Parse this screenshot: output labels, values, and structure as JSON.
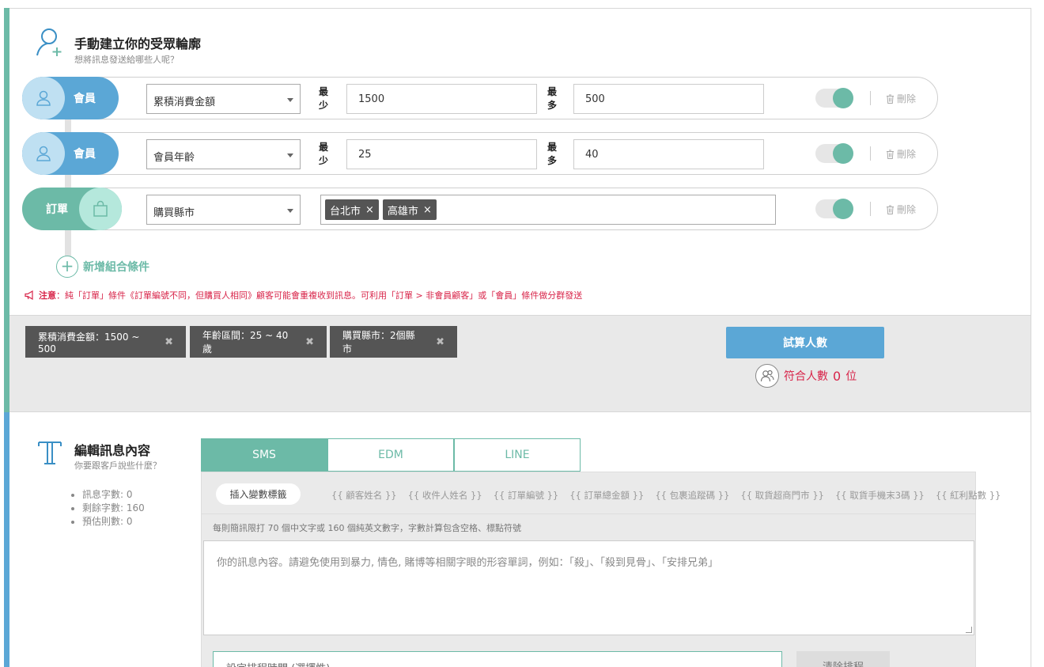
{
  "audience": {
    "title": "手動建立你的受眾輪廓",
    "subtitle": "想將訊息發送給哪些人呢？",
    "rules": [
      {
        "type_label": "會員",
        "field": "累積消費金額",
        "min_label": "最少",
        "min": "1500",
        "max_label": "最多",
        "max": "500",
        "delete_label": "刪除"
      },
      {
        "type_label": "會員",
        "field": "會員年齡",
        "min_label": "最少",
        "min": "25",
        "max_label": "最多",
        "max": "40",
        "delete_label": "刪除"
      },
      {
        "type_label": "訂單",
        "field": "購買縣市",
        "tags": [
          "台北市",
          "高雄市"
        ],
        "delete_label": "刪除"
      }
    ],
    "add_condition_label": "新增組合條件",
    "notice_prefix": "注意",
    "notice_text": "：純「訂單」條件《訂單編號不同，但購買人相同》顧客可能會重複收到訊息。可利用「訂單 > 非會員顧客」或「會員」條件做分群發送"
  },
  "summary": {
    "chips": [
      "累積消費金額：1500 ~ 500",
      "年齡區間：25 ~ 40歲",
      "購買縣市：2個縣市"
    ],
    "calc_button": "試算人數",
    "match_label": "符合人數",
    "match_count": "0",
    "match_unit": "位"
  },
  "content": {
    "title": "編輯訊息內容",
    "subtitle": "你要跟客戶說些什麼？",
    "stats": [
      "訊息字數: 0",
      "剩餘字數: 160",
      "預估則數: 0"
    ],
    "tabs": [
      "SMS",
      "EDM",
      "LINE"
    ],
    "active_tab": "SMS",
    "insert_button": "插入變數標籤",
    "variables": [
      "{{ 顧客姓名 }}",
      "{{ 收件人姓名 }}",
      "{{ 訂單編號 }}",
      "{{ 訂單總金額 }}",
      "{{ 包裹追蹤碼 }}",
      "{{ 取貨超商門市 }}",
      "{{ 取貨手機末3碼 }}",
      "{{ 紅利點數 }}"
    ],
    "hint": "每則簡訊限打 70 個中文字或 160 個純英文數字，字數計算包含空格、標點符號",
    "placeholder": "你的訊息內容。請避免使用到暴力, 情色, 賭博等相關字眼的形容單詞，例如：「殺」、「殺到見骨」、「安排兄弟」",
    "schedule_placeholder": "設定排程時間 (選擇性)",
    "clear_button": "清除排程"
  },
  "colors": {
    "green": "#6cbaa7",
    "blue": "#5ba7d6",
    "alert": "#d8254a",
    "chip": "#555555"
  }
}
